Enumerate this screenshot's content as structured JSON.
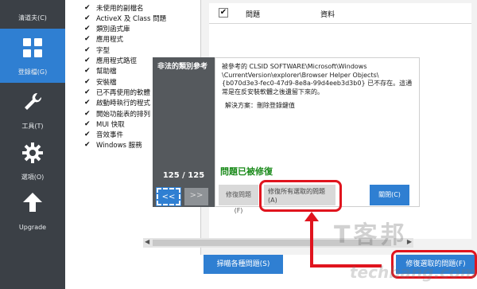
{
  "sidebar": {
    "items": [
      {
        "label": "清道夫(C)",
        "icon": "broom-icon"
      },
      {
        "label": "登錄檔(G)",
        "icon": "grid-icon",
        "active": true
      },
      {
        "label": "工具(T)",
        "icon": "wrench-icon"
      },
      {
        "label": "選項(O)",
        "icon": "gear-icon"
      },
      {
        "label": "Upgrade",
        "icon": "arrow-up-icon"
      }
    ]
  },
  "checklist": [
    "未使用的副檔名",
    "ActiveX 及 Class 問題",
    "類別函式庫",
    "應用程式",
    "字型",
    "應用程式路徑",
    "幫助檔",
    "安裝檔",
    "已不再使用的軟體",
    "啟動時執行的程式",
    "開始功能表的排列",
    "MUI 快取",
    "音效事件",
    "Windows 服務"
  ],
  "results": {
    "header": {
      "check": "✔",
      "col_problem": "問題",
      "col_data": "資料"
    }
  },
  "dialog": {
    "title": "非法的類別參考",
    "counter": "125 / 125",
    "prev": "<<",
    "next": ">>",
    "description": "被參考的 CLSID SOFTWARE\\Microsoft\\Windows \\CurrentVersion\\explorer\\Browser Helper Objects\\{b070d3e3-fec0-47d9-8e8a-99d4eeb3d3b0} 已不存在。這通常是在反安裝軟體之後遺留下來的。",
    "solution": "解決方案：刪除登錄鍵值",
    "status": "問題已被修復",
    "fix_button": "修復問題(F)",
    "fix_all_button": "修復所有選取的問題(A)",
    "close_button": "關閉(C)"
  },
  "bottom": {
    "scan_button": "掃瞄各種問題(S)",
    "fix_selected_button": "修復選取的問題(F)"
  },
  "watermark": {
    "text": "T客邦",
    "sub": "techbang.com"
  },
  "colors": {
    "accent": "#2f7fd2",
    "sidebar": "#3b4046",
    "highlight": "#e0141e",
    "success": "#1a8a1a"
  }
}
